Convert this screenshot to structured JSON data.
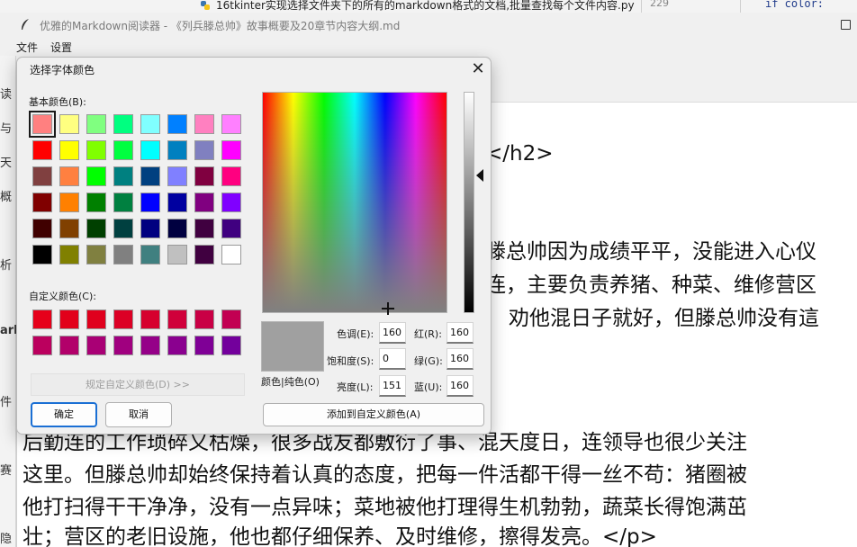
{
  "background_tab": {
    "filename": "16tkinter实现选择文件夹下的所有的markdown格式的文档,批量查找每个文件内容.py",
    "line_number": "229",
    "code_fragment": "if color:"
  },
  "app": {
    "title": "优雅的Markdown阅读器 - 《列兵滕总帅》故事概要及20章节内容大纲.md",
    "menu": [
      "文件",
      "设置"
    ],
    "left_fragments": [
      "读",
      "与",
      "天",
      "概",
      "析",
      "arl",
      "件",
      "赛",
      "隐"
    ],
    "content_lines": [
      "</h2>",
      "滕总帅因为成绩平平，没能进入心仪",
      "连，主要负责养猪、种菜、维修营区",
      "劝他混日子就好，但滕总帅没有這",
      "后勤连的工作琐碎又枯燥，很多战友都敷衍了事、混天度日，连领导也很少关注",
      "这里。但滕总帅却始终保持着认真的态度，把每一件活都干得一丝不苟：猪圈被",
      "他打扫得干干净净，没有一点异味；菜地被他打理得生机勃勃，蔬菜长得饱满茁",
      "壮；营区的老旧设施，他也都仔细保养、及时维修，擦得发亮。</p>"
    ]
  },
  "dialog": {
    "title": "选择字体颜色",
    "close_icon": "close-icon",
    "basic_colors_label": "基本颜色(B):",
    "basic_colors": [
      "#ff8080",
      "#ffff80",
      "#80ff80",
      "#00ff80",
      "#80ffff",
      "#0080ff",
      "#ff80c0",
      "#ff80ff",
      "#ff0000",
      "#ffff00",
      "#80ff00",
      "#00ff40",
      "#00ffff",
      "#0080c0",
      "#8080c0",
      "#ff00ff",
      "#804040",
      "#ff8040",
      "#00ff00",
      "#008080",
      "#004080",
      "#8080ff",
      "#800040",
      "#ff0080",
      "#800000",
      "#ff8000",
      "#008000",
      "#008040",
      "#0000ff",
      "#0000a0",
      "#800080",
      "#8000ff",
      "#400000",
      "#804000",
      "#004000",
      "#004040",
      "#000080",
      "#000040",
      "#400040",
      "#400080",
      "#000000",
      "#808000",
      "#808040",
      "#808080",
      "#408080",
      "#c0c0c0",
      "#400040",
      "#ffffff"
    ],
    "selected_index": 0,
    "custom_colors_label": "自定义颜色(C):",
    "custom_colors": [
      "#e6001a",
      "#e2001a",
      "#e0001d",
      "#dc0025",
      "#d6002e",
      "#d0003a",
      "#c90045",
      "#c20052",
      "#bb005e",
      "#b2006a",
      "#a90075",
      "#a0007f",
      "#950088",
      "#8a008f",
      "#7f0096",
      "#73009c"
    ],
    "define_custom_button": "规定自定义颜色(D) >>",
    "ok_button": "确定",
    "cancel_button": "取消",
    "preview_label": "颜色|纯色(O)",
    "preview_color": "#a0a0a0",
    "hue_label": "色调(E):",
    "hue_value": "160",
    "sat_label": "饱和度(S):",
    "sat_value": "0",
    "lum_label": "亮度(L):",
    "lum_value": "151",
    "red_label": "红(R):",
    "red_value": "160",
    "green_label": "绿(G):",
    "green_value": "160",
    "blue_label": "蓝(U):",
    "blue_value": "160",
    "add_custom_button": "添加到自定义颜色(A)"
  }
}
